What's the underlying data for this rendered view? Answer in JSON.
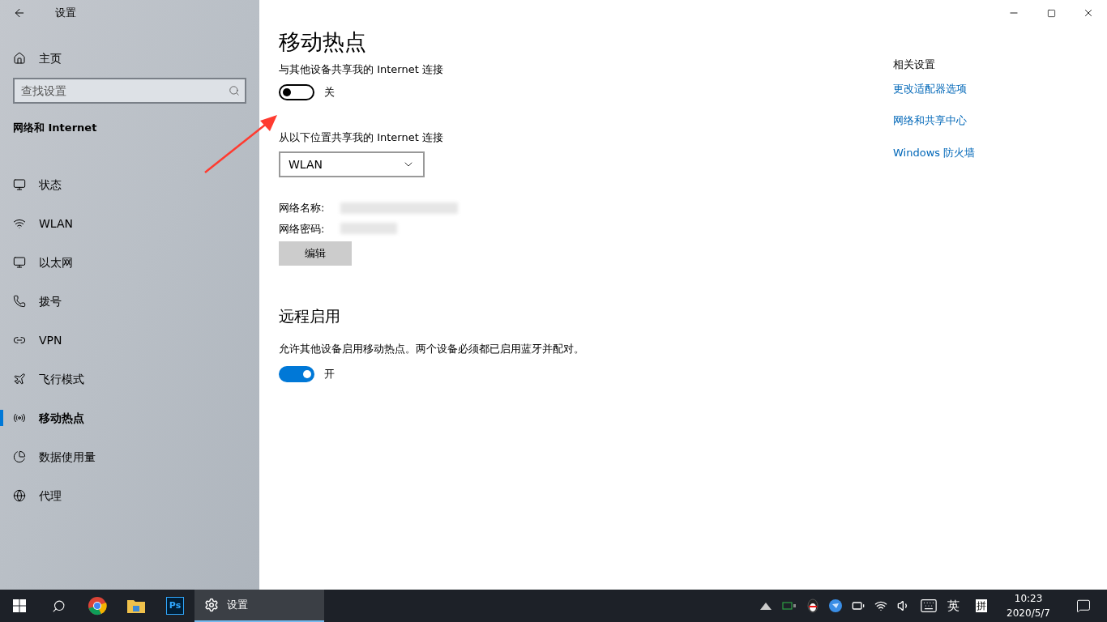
{
  "window": {
    "title": "设置"
  },
  "sidebar": {
    "home": "主页",
    "search": {
      "placeholder": "查找设置"
    },
    "section": "网络和 Internet",
    "items": [
      {
        "label": "状态",
        "selected": false
      },
      {
        "label": "WLAN",
        "selected": false
      },
      {
        "label": "以太网",
        "selected": false
      },
      {
        "label": "拨号",
        "selected": false
      },
      {
        "label": "VPN",
        "selected": false
      },
      {
        "label": "飞行模式",
        "selected": false
      },
      {
        "label": "移动热点",
        "selected": true
      },
      {
        "label": "数据使用量",
        "selected": false
      },
      {
        "label": "代理",
        "selected": false
      }
    ]
  },
  "main": {
    "title": "移动热点",
    "share": {
      "label": "与其他设备共享我的 Internet 连接",
      "on": false,
      "state_label": "关"
    },
    "share_from": {
      "label": "从以下位置共享我的 Internet 连接",
      "value": "WLAN"
    },
    "network_name": {
      "label": "网络名称:"
    },
    "network_password": {
      "label": "网络密码:"
    },
    "edit_button": "编辑",
    "remote": {
      "heading": "远程启用",
      "description": "允许其他设备启用移动热点。两个设备必须都已启用蓝牙并配对。",
      "on": true,
      "state_label": "开"
    }
  },
  "related": {
    "heading": "相关设置",
    "links": [
      "更改适配器选项",
      "网络和共享中心",
      "Windows 防火墙"
    ]
  },
  "taskbar": {
    "ps_label": "Ps",
    "active_app": {
      "label": "设置",
      "selected": true
    },
    "input_mode": "英",
    "ime": "拼",
    "time": "10:23",
    "date": "2020/5/7"
  }
}
